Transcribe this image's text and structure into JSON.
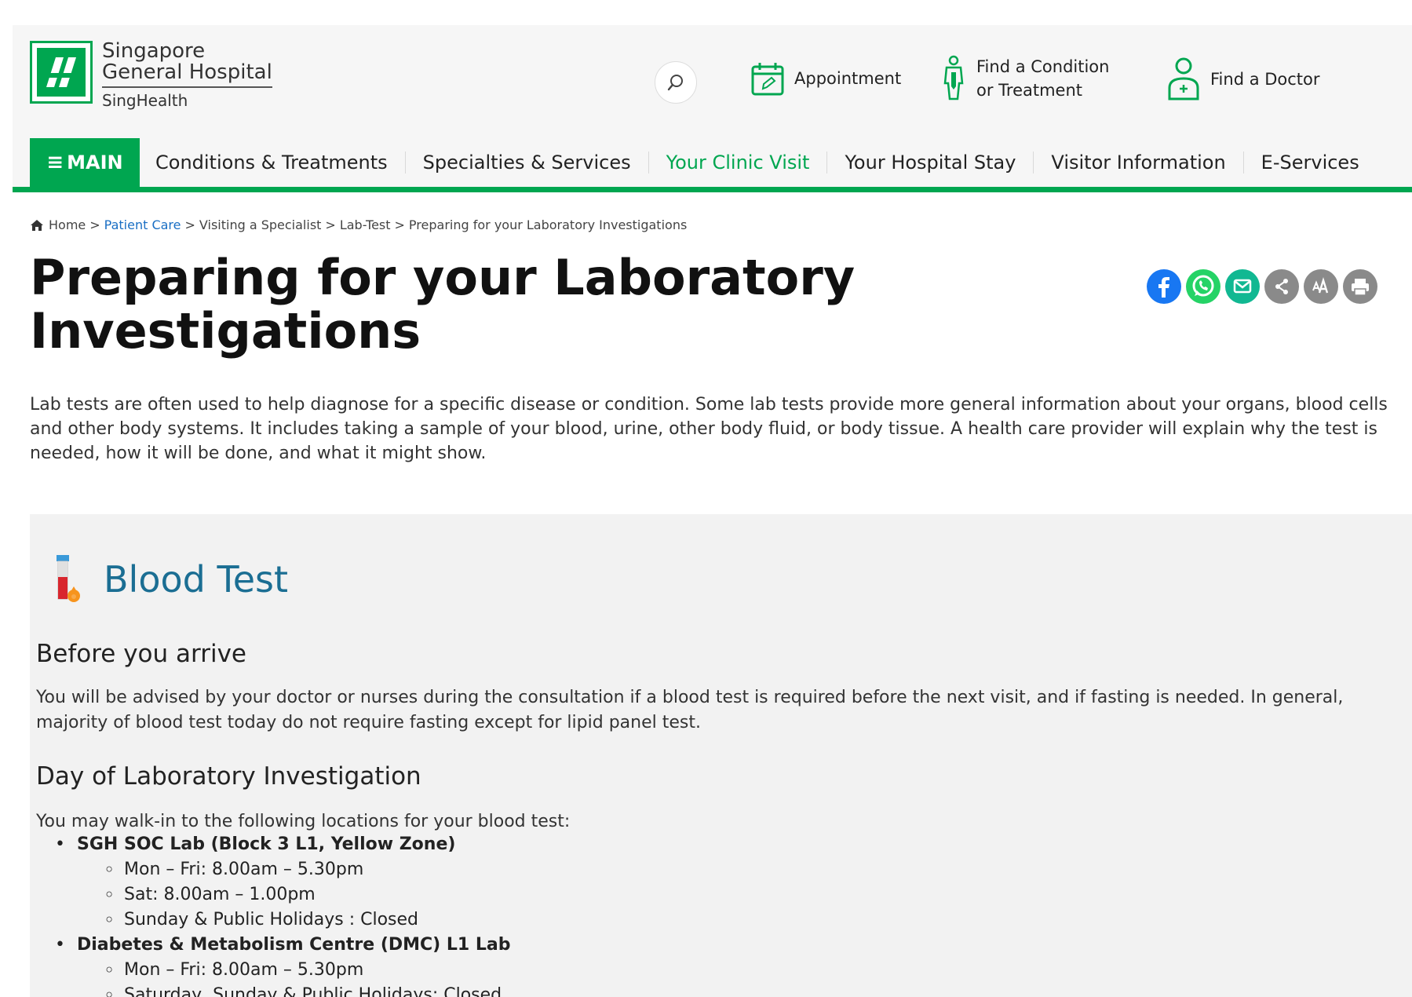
{
  "logo": {
    "line1": "Singapore",
    "line2": "General Hospital",
    "line3": "SingHealth",
    "brand_color": "#00a650"
  },
  "header": {
    "search_icon": "search-icon",
    "tools": {
      "appointment": "Appointment",
      "find_condition": "Find a Condition\nor Treatment",
      "find_doctor": "Find a Doctor"
    }
  },
  "nav": {
    "main_label": "MAIN",
    "items": [
      "Conditions & Treatments",
      "Specialties & Services",
      "Your Clinic Visit",
      "Your Hospital Stay",
      "Visitor Information",
      "E-Services"
    ],
    "active_item": "Your Clinic Visit",
    "active_color": "#00a650"
  },
  "breadcrumb": {
    "home": "Home",
    "patient_care": "Patient Care",
    "visiting": "Visiting a Specialist",
    "lab_test": "Lab-Test",
    "current": "Preparing for your Laboratory Investigations",
    "separator": ">"
  },
  "page": {
    "title": "Preparing for your Laboratory Investigations",
    "intro": "Lab tests are often used to help diagnose for a specific disease or condition. Some lab tests provide more general information about your organs, blood cells and other body systems. It includes taking a sample of your blood, urine, other body fluid, or body tissue. A health care provider will explain why the test is needed, how it will be done, and what it might show."
  },
  "share": {
    "icons": [
      "facebook-icon",
      "whatsapp-icon",
      "email-icon",
      "share-icon",
      "font-size-icon",
      "print-icon"
    ],
    "colors": {
      "facebook": "#1877f2",
      "whatsapp": "#25d366",
      "email": "#11b892",
      "grey": "#8a8a8a"
    }
  },
  "blood_test": {
    "title": "Blood Test",
    "title_color": "#1b6e93",
    "before_heading": "Before you arrive",
    "before_text": "You will be advised by your doctor or nurses during the consultation if a blood test is required before the next visit, and if fasting is needed. In general, majority of blood test today do not require fasting except for lipid panel test.",
    "day_heading": "Day of Laboratory Investigation",
    "day_text": "You may walk-in to the following locations for your blood test:",
    "locations": [
      {
        "name": "SGH SOC Lab (Block 3 L1, Yellow Zone)",
        "hours": [
          "Mon – Fri: 8.00am – 5.30pm",
          "Sat: 8.00am – 1.00pm",
          "Sunday & Public Holidays : Closed"
        ]
      },
      {
        "name": "Diabetes & Metabolism Centre (DMC) L1 Lab",
        "hours": [
          "Mon – Fri: 8.00am – 5.30pm",
          "Saturday, Sunday & Public Holidays: Closed"
        ]
      }
    ]
  }
}
